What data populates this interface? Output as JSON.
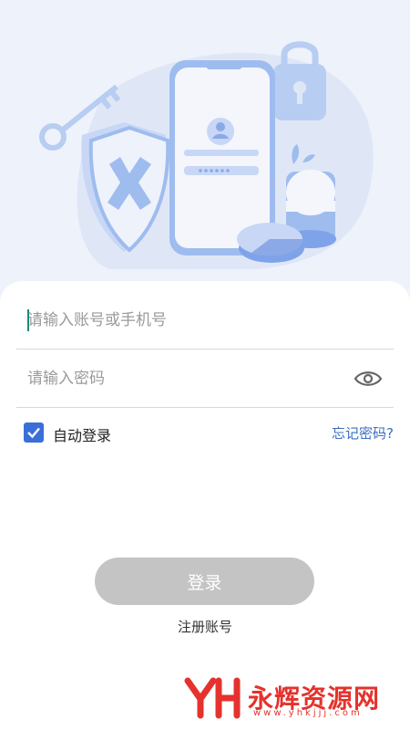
{
  "form": {
    "account_placeholder": "请输入账号或手机号",
    "password_placeholder": "请输入密码",
    "remember_label": "自动登录",
    "remember_checked": true,
    "forgot_label": "忘记密码?",
    "login_label": "登录",
    "register_label": "注册账号"
  },
  "watermark": {
    "brand": "永辉资源网",
    "url": "www.yhkjjj.com"
  },
  "colors": {
    "accent": "#3b6fd8",
    "link": "#3b6fbf",
    "button_disabled": "#c4c4c4",
    "illustration_blue": "#9fbcef",
    "watermark": "#e5322d"
  },
  "icons": {
    "password_toggle": "eye-icon",
    "checkbox": "check-icon"
  }
}
